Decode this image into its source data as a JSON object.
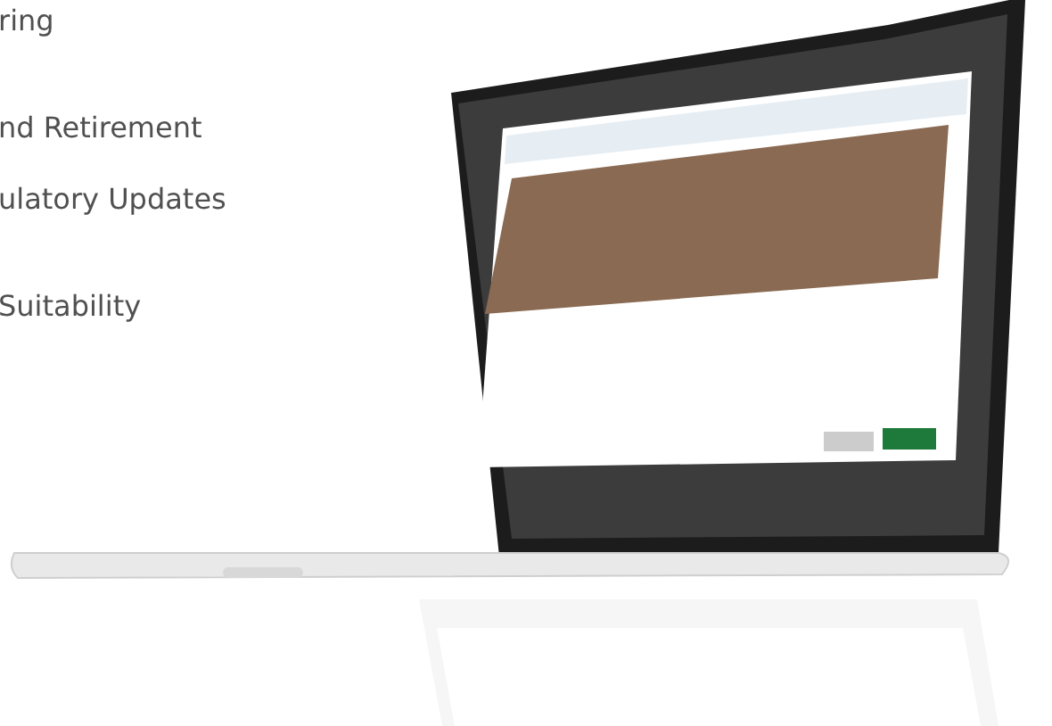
{
  "feature_list": [
    "ring",
    "nd Retirement",
    "ulatory Updates",
    "Suitability"
  ]
}
